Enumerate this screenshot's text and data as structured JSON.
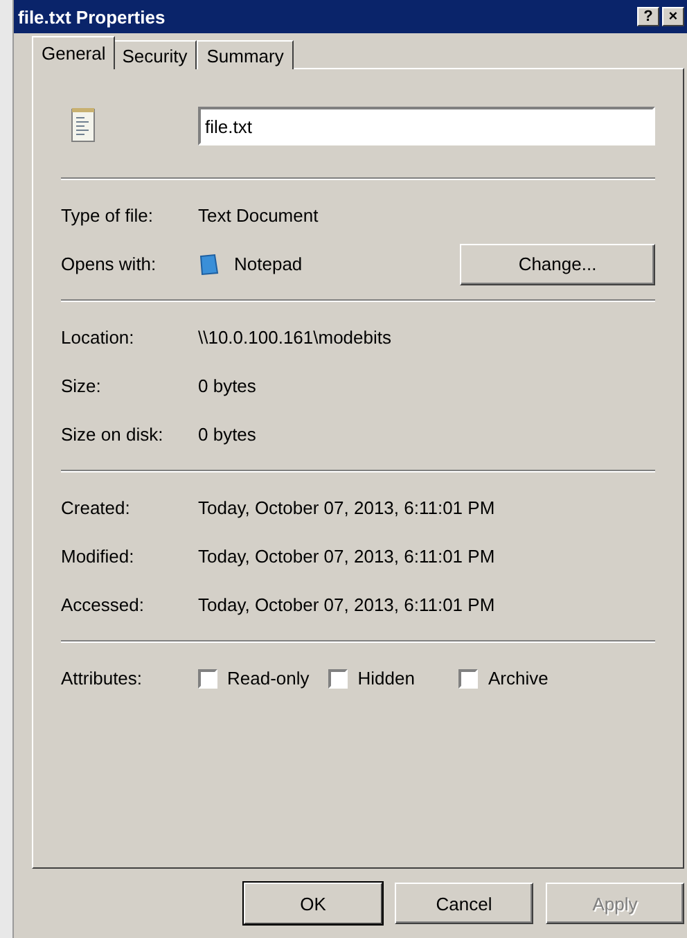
{
  "window": {
    "title": "file.txt Properties",
    "title_buttons": [
      "?",
      "×"
    ]
  },
  "tabs": [
    {
      "label": "General",
      "selected": true
    },
    {
      "label": "Security",
      "selected": false
    },
    {
      "label": "Summary",
      "selected": false
    }
  ],
  "file_name": {
    "value": "file.txt"
  },
  "sections": [
    [
      {
        "kind": "text",
        "label": "Type of file:",
        "value": "Text Document"
      },
      {
        "kind": "app",
        "label": "Opens with:",
        "value": "Notepad",
        "button": "Change..."
      }
    ],
    [
      {
        "kind": "text",
        "label": "Location:",
        "value": "\\\\10.0.100.161\\modebits"
      },
      {
        "kind": "text",
        "label": "Size:",
        "value": "0 bytes"
      },
      {
        "kind": "text",
        "label": "Size on disk:",
        "value": "0 bytes"
      }
    ],
    [
      {
        "kind": "text",
        "label": "Created:",
        "value": "Today, October 07, 2013, 6:11:01 PM"
      },
      {
        "kind": "text",
        "label": "Modified:",
        "value": "Today, October 07, 2013, 6:11:01 PM"
      },
      {
        "kind": "text",
        "label": "Accessed:",
        "value": "Today, October 07, 2013, 6:11:01 PM"
      }
    ]
  ],
  "attributes": {
    "label": "Attributes:",
    "options": [
      {
        "label": "Read-only",
        "checked": false
      },
      {
        "label": "Hidden",
        "checked": false
      },
      {
        "label": "Archive",
        "checked": false
      }
    ]
  },
  "buttons": [
    {
      "label": "OK",
      "disabled": false,
      "default": true
    },
    {
      "label": "Cancel",
      "disabled": false,
      "default": false
    },
    {
      "label": "Apply",
      "disabled": true,
      "default": false
    }
  ]
}
